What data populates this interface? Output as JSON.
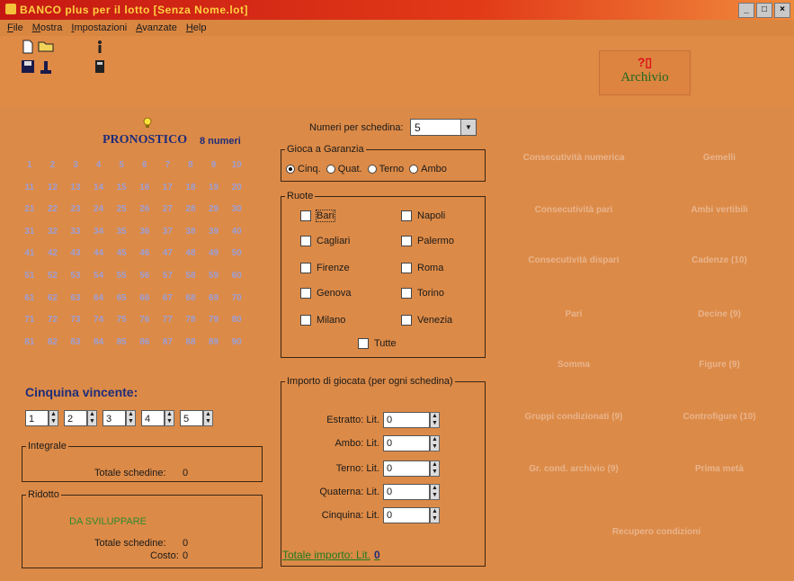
{
  "window": {
    "title": "BANCO plus per il lotto [Senza Nome.lot]",
    "controls": [
      "_",
      "□",
      "×"
    ]
  },
  "menu": [
    "File",
    "Mostra",
    "Impostazioni",
    "Avanzate",
    "Help"
  ],
  "toolbar": {
    "archivio_symbol": "?▯",
    "archivio_label": "Archivio",
    "icons": [
      "new-file-icon",
      "open-folder-icon",
      "info-icon",
      "save-icon",
      "pipe-icon",
      "calculator-icon"
    ]
  },
  "pronostico": {
    "title": "PRONOSTICO",
    "count": "8 numeri",
    "numbers": [
      "1",
      "2",
      "3",
      "4",
      "5",
      "6",
      "7",
      "8",
      "9",
      "10",
      "11",
      "12",
      "13",
      "14",
      "15",
      "16",
      "17",
      "18",
      "19",
      "20",
      "21",
      "22",
      "23",
      "24",
      "25",
      "26",
      "27",
      "28",
      "29",
      "30",
      "31",
      "32",
      "33",
      "34",
      "35",
      "36",
      "37",
      "38",
      "39",
      "40",
      "41",
      "42",
      "43",
      "44",
      "45",
      "46",
      "47",
      "48",
      "49",
      "50",
      "51",
      "52",
      "53",
      "54",
      "55",
      "56",
      "57",
      "58",
      "59",
      "60",
      "61",
      "62",
      "63",
      "64",
      "65",
      "66",
      "67",
      "68",
      "69",
      "70",
      "71",
      "72",
      "73",
      "74",
      "75",
      "76",
      "77",
      "78",
      "79",
      "80",
      "81",
      "82",
      "83",
      "84",
      "85",
      "86",
      "87",
      "88",
      "89",
      "90"
    ]
  },
  "cinquina": {
    "title": "Cinquina vincente:",
    "values": [
      "1",
      "2",
      "3",
      "4",
      "5"
    ]
  },
  "integrale": {
    "legend": "Integrale",
    "totale_label": "Totale schedine:",
    "totale_value": "0"
  },
  "ridotto": {
    "legend": "Ridotto",
    "note": "DA SVILUPPARE",
    "totale_label": "Totale schedine:",
    "totale_value": "0",
    "costo_label": "Costo:",
    "costo_value": "0"
  },
  "numeri_per_schedina": {
    "label": "Numeri per schedina:",
    "value": "5"
  },
  "gioca_garanzia": {
    "legend": "Gioca a Garanzia",
    "options": [
      {
        "label": "Cinq.",
        "selected": true
      },
      {
        "label": "Quat.",
        "selected": false
      },
      {
        "label": "Terno",
        "selected": false
      },
      {
        "label": "Ambo",
        "selected": false
      }
    ]
  },
  "ruote": {
    "legend": "Ruote",
    "left": [
      "Bari",
      "Cagliari",
      "Firenze",
      "Genova",
      "Milano"
    ],
    "right": [
      "Napoli",
      "Palermo",
      "Roma",
      "Torino",
      "Venezia"
    ],
    "tutte": "Tutte"
  },
  "importo": {
    "legend": "Importo di giocata (per ogni schedina)",
    "rows": [
      {
        "label": "Estratto: Lit.",
        "value": "0"
      },
      {
        "label": "Ambo: Lit.",
        "value": "0"
      },
      {
        "label": "Terno: Lit.",
        "value": "0"
      },
      {
        "label": "Quaterna: Lit.",
        "value": "0"
      },
      {
        "label": "Cinquina: Lit.",
        "value": "0"
      }
    ],
    "totale_label": "Totale importo: Lit.",
    "totale_value": "0"
  },
  "funzioni": {
    "left": [
      "Consecutività numerica",
      "Consecutività pari",
      "Consecutività dispari",
      "Pari",
      "Somma",
      "Gruppi condizionati (9)",
      "Gr. cond. archivio (9)"
    ],
    "right": [
      "Gemelli",
      "Ambi vertibili",
      "Cadenze (10)",
      "Decine (9)",
      "Figure (9)",
      "Controfigure (10)",
      "Prima metà"
    ],
    "bottom": "Recupero condizioni"
  }
}
